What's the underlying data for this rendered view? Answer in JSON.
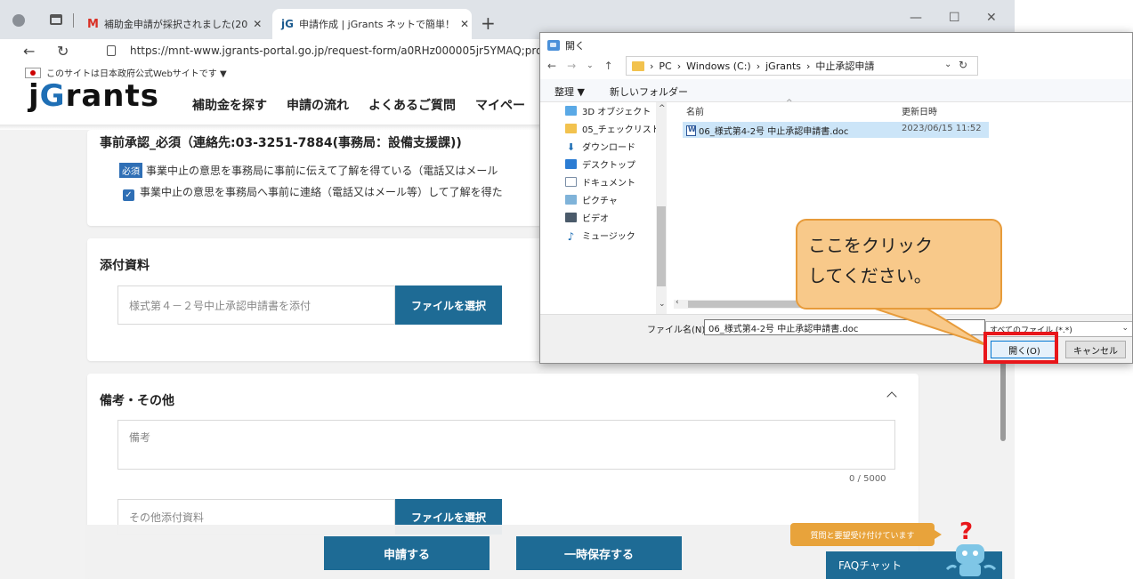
{
  "browser": {
    "tabs": [
      {
        "label": "補助金申請が採択されました(20",
        "icon": "gmail-icon"
      },
      {
        "label": "申請作成 | jGrants ネットで簡単！",
        "icon": "jgrants-icon"
      }
    ],
    "url": "https://mnt-www.jgrants-portal.go.jp/request-form/a0RHz000005jr5YMAQ;proje"
  },
  "page": {
    "gov_notice": "このサイトは日本政府公式Webサイトです ▼",
    "logo_prefix": "j",
    "logo_g": "G",
    "logo_suffix": "rants",
    "nav": [
      "補助金を探す",
      "申請の流れ",
      "よくあるご質問",
      "マイペー"
    ],
    "prior_approval": {
      "title": "事前承認_必須（連絡先:03-3251-7884(事務局：設備支援課))",
      "required_badge": "必須",
      "required_text": "事業中止の意思を事務局に事前に伝えて了解を得ている（電話又はメール",
      "checkbox_text": "事業中止の意思を事務局へ事前に連絡（電話又はメール等）して了解を得た"
    },
    "attachments": {
      "title": "添付資料",
      "file_placeholder": "様式第４－２号中止承認申請書を添付",
      "file_button": "ファイルを選択"
    },
    "remarks": {
      "title": "備考・その他",
      "remarks_placeholder": "備考",
      "counter": "0 / 5000",
      "other_file_placeholder": "その他添付資料",
      "file_button": "ファイルを選択"
    },
    "footer": {
      "submit": "申請する",
      "save": "一時保存する"
    },
    "faq": {
      "bubble": "質問と要望受け付けています",
      "tab": "FAQチャット"
    }
  },
  "dialog": {
    "title": "開く",
    "path": [
      "PC",
      "Windows (C:)",
      "jGrants",
      "中止承認申請"
    ],
    "toolbar": {
      "organize": "整理 ▼",
      "new_folder": "新しいフォルダー"
    },
    "tree": [
      "3D オブジェクト",
      "05_チェックリスト",
      "ダウンロード",
      "デスクトップ",
      "ドキュメント",
      "ピクチャ",
      "ビデオ",
      "ミュージック"
    ],
    "columns": {
      "name": "名前",
      "modified": "更新日時"
    },
    "file": {
      "name": "06_様式第4-2号 中止承認申請書.doc",
      "modified": "2023/06/15 11:52"
    },
    "filename_label": "ファイル名(N):",
    "filename_value": "06_様式第4-2号 中止承認申請書.doc",
    "filter": "すべてのファイル (*.*)",
    "open_button": "開く(O)",
    "cancel_button": "キャンセル"
  },
  "callout": {
    "line1": "ここをクリック",
    "line2": "してください。"
  },
  "colors": {
    "accent": "#1e6b95",
    "callout_fill": "#f8c98a",
    "highlight": "#e8161a"
  }
}
